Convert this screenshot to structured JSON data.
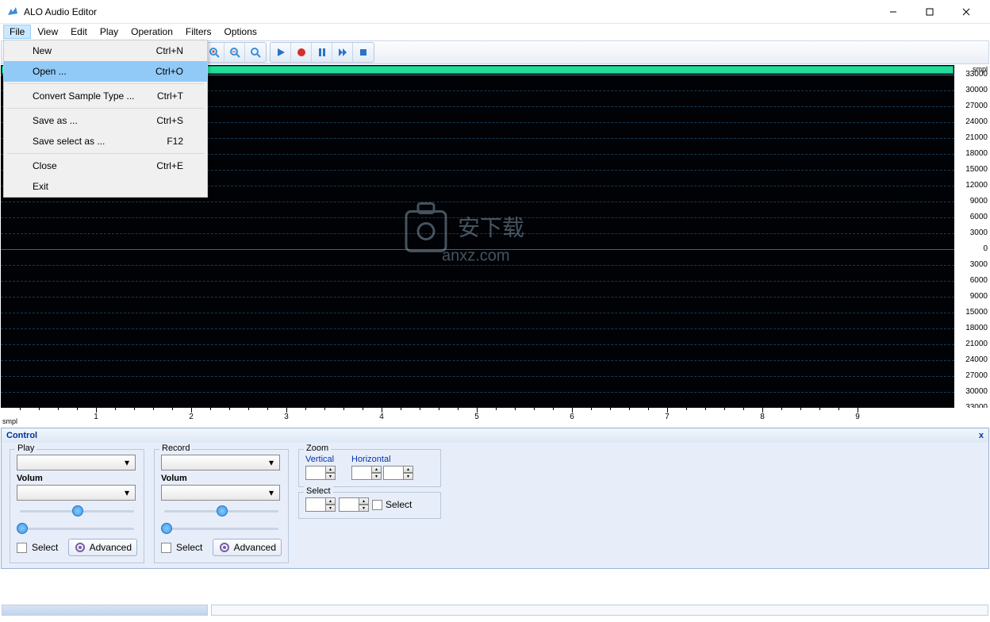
{
  "app": {
    "title": "ALO Audio Editor"
  },
  "menus": [
    "File",
    "View",
    "Edit",
    "Play",
    "Operation",
    "Filters",
    "Options"
  ],
  "file_menu": [
    {
      "label": "New",
      "shortcut": "Ctrl+N"
    },
    {
      "label": "Open ...",
      "shortcut": "Ctrl+O",
      "hover": true
    },
    {
      "sep": true
    },
    {
      "label": "Convert Sample Type ...",
      "shortcut": "Ctrl+T"
    },
    {
      "sep": true
    },
    {
      "label": "Save as ...",
      "shortcut": "Ctrl+S"
    },
    {
      "label": "Save select as ...",
      "shortcut": "F12"
    },
    {
      "sep": true
    },
    {
      "label": "Close",
      "shortcut": "Ctrl+E"
    },
    {
      "label": "Exit",
      "shortcut": ""
    }
  ],
  "right_axis": {
    "unit": "smpl",
    "ticks": [
      "33000",
      "30000",
      "27000",
      "24000",
      "21000",
      "18000",
      "15000",
      "12000",
      "9000",
      "6000",
      "3000",
      "0",
      "3000",
      "6000",
      "9000",
      "15000",
      "18000",
      "21000",
      "24000",
      "27000",
      "30000",
      "33000"
    ]
  },
  "time_ruler": {
    "unit": "smpl",
    "ticks": [
      "1",
      "2",
      "3",
      "4",
      "5",
      "6",
      "7",
      "8",
      "9"
    ]
  },
  "control": {
    "title": "Control",
    "close": "x",
    "play": {
      "title": "Play",
      "volume_label": "Volum",
      "select": "Select",
      "advanced": "Advanced"
    },
    "record": {
      "title": "Record",
      "volume_label": "Volum",
      "select": "Select",
      "advanced": "Advanced"
    },
    "zoom": {
      "title": "Zoom",
      "vertical": "Vertical",
      "horizontal": "Horizontal"
    },
    "select": {
      "title": "Select",
      "label": "Select"
    }
  },
  "watermark": {
    "text1": "安下载",
    "text2": "anxz.com"
  }
}
